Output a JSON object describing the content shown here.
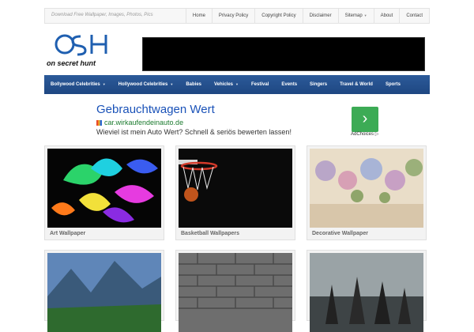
{
  "topbar": {
    "tagline": "Download Free Wallpaper, Images, Photos, Pics",
    "links": [
      "Home",
      "Privacy Policy",
      "Copyright Policy",
      "Disclaimer",
      "Sitemap",
      "About",
      "Contact"
    ]
  },
  "logo": {
    "text": "on secret hunt",
    "monogram": "OSH"
  },
  "mainnav": {
    "items": [
      "Bollywood Celebrities",
      "Hollywood Celebrities",
      "Babies",
      "Vehicles",
      "Festival",
      "Events",
      "Singers",
      "Travel & World",
      "Sports"
    ]
  },
  "ad": {
    "title": "Gebrauchtwagen Wert",
    "url": "car.wirkaufendeinauto.de",
    "description": "Wieviel ist mein Auto Wert? Schnell & seriös bewerten lassen!",
    "adchoices": "AdChoices"
  },
  "cards": [
    {
      "caption": "Art Wallpaper"
    },
    {
      "caption": "Basketball Wallpapers"
    },
    {
      "caption": "Decorative Wallpaper"
    },
    {
      "caption": ""
    },
    {
      "caption": ""
    },
    {
      "caption": ""
    }
  ],
  "colors": {
    "nav": "#24508c",
    "ad_title": "#1a52b8",
    "ad_url": "#1b7b2e",
    "ad_button": "#3cab55"
  }
}
